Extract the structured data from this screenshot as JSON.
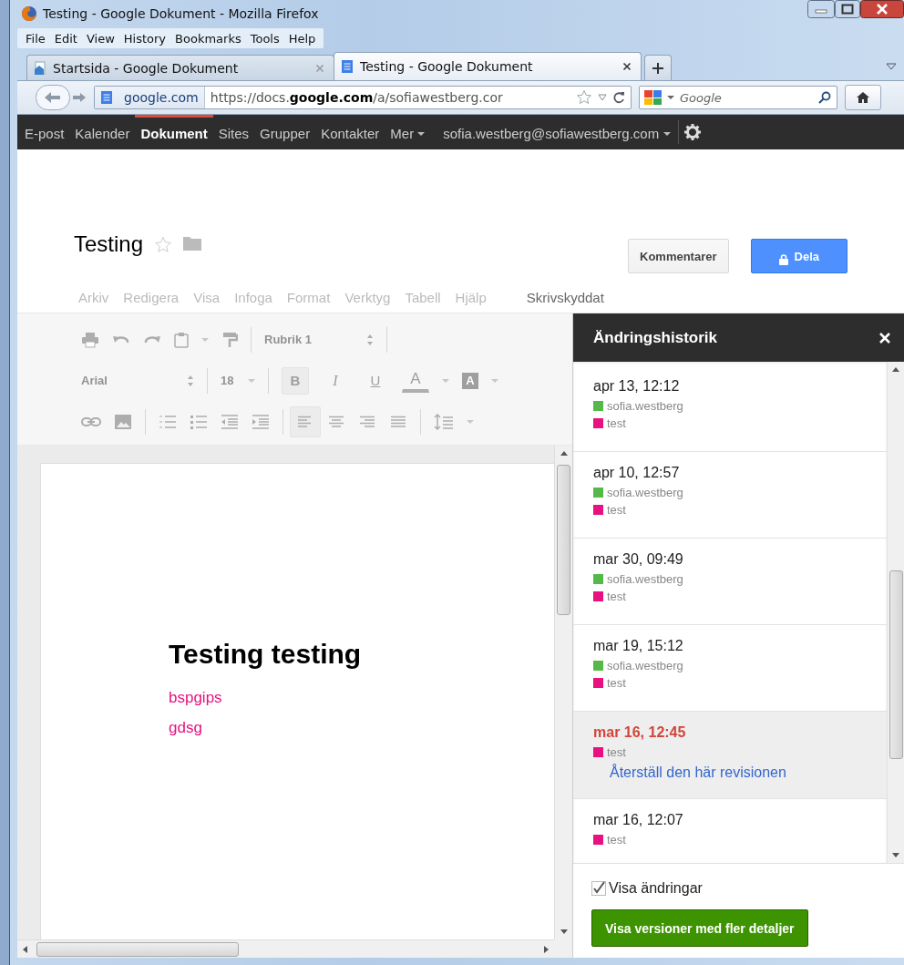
{
  "window": {
    "title": "Testing - Google Dokument - Mozilla Firefox"
  },
  "menu_bar": [
    {
      "label": "File"
    },
    {
      "label": "Edit"
    },
    {
      "label": "View"
    },
    {
      "label": "History"
    },
    {
      "label": "Bookmarks"
    },
    {
      "label": "Tools"
    },
    {
      "label": "Help"
    }
  ],
  "tabs": [
    {
      "label": "Startsida - Google Dokument",
      "selected": false
    },
    {
      "label": "Testing - Google Dokument",
      "selected": true
    }
  ],
  "address_bar": {
    "site": "google.com",
    "url": "https://docs.**google.com**/a/sofiawestberg.cor"
  },
  "search": {
    "placeholder": "Google"
  },
  "google_bar": {
    "items": [
      {
        "label": "E-post",
        "selected": false,
        "dropdown": false
      },
      {
        "label": "Kalender",
        "selected": false,
        "dropdown": false
      },
      {
        "label": "Dokument",
        "selected": true,
        "dropdown": false
      },
      {
        "label": "Sites",
        "selected": false,
        "dropdown": false
      },
      {
        "label": "Grupper",
        "selected": false,
        "dropdown": false
      },
      {
        "label": "Kontakter",
        "selected": false,
        "dropdown": false
      },
      {
        "label": "Mer",
        "selected": false,
        "dropdown": true
      }
    ],
    "account": "sofia.westberg@sofiawestberg.com"
  },
  "document": {
    "title": "Testing",
    "starred": false,
    "menu": [
      {
        "label": "Arkiv",
        "disabled": true
      },
      {
        "label": "Redigera",
        "disabled": true
      },
      {
        "label": "Visa",
        "disabled": true
      },
      {
        "label": "Infoga",
        "disabled": true
      },
      {
        "label": "Format",
        "disabled": true
      },
      {
        "label": "Verktyg",
        "disabled": true
      },
      {
        "label": "Tabell",
        "disabled": true
      },
      {
        "label": "Hjälp",
        "disabled": true
      }
    ],
    "status": "Skrivskyddat",
    "buttons": [
      {
        "label": "Kommentarer",
        "kind": "plain"
      },
      {
        "label": "Dela",
        "kind": "share"
      }
    ]
  },
  "toolbar": {
    "disabled": true,
    "paragraph_style": "Rubrik 1",
    "font": "Arial",
    "font_size": "18",
    "align_buttons": [
      {
        "kind": "left",
        "pressed": true
      },
      {
        "kind": "center",
        "pressed": false
      },
      {
        "kind": "right",
        "pressed": false
      },
      {
        "kind": "justify",
        "pressed": false
      }
    ],
    "format_buttons": [
      {
        "label": "B",
        "kind": "bold",
        "pressed": true
      },
      {
        "label": "I",
        "kind": "italic",
        "pressed": false
      },
      {
        "label": "U",
        "kind": "underline",
        "pressed": false
      },
      {
        "label": "A",
        "kind": "text_color",
        "pressed": false
      },
      {
        "label": "A",
        "kind": "highlight",
        "pressed": false
      }
    ]
  },
  "page": {
    "heading": "Testing testing",
    "lines": [
      {
        "text": "bspgips",
        "color": "#e8117f"
      },
      {
        "text": "gdsg",
        "color": "#e8117f"
      }
    ]
  },
  "history": {
    "title": "Ändringshistorik",
    "revisions": [
      {
        "time": "apr 13, 12:12",
        "selected": false,
        "authors": [
          {
            "name": "sofia.westberg",
            "color": "#54b948"
          },
          {
            "name": "test",
            "color": "#e8117f"
          }
        ]
      },
      {
        "time": "apr 10, 12:57",
        "selected": false,
        "authors": [
          {
            "name": "sofia.westberg",
            "color": "#54b948"
          },
          {
            "name": "test",
            "color": "#e8117f"
          }
        ]
      },
      {
        "time": "mar 30, 09:49",
        "selected": false,
        "authors": [
          {
            "name": "sofia.westberg",
            "color": "#54b948"
          },
          {
            "name": "test",
            "color": "#e8117f"
          }
        ]
      },
      {
        "time": "mar 19, 15:12",
        "selected": false,
        "authors": [
          {
            "name": "sofia.westberg",
            "color": "#54b948"
          },
          {
            "name": "test",
            "color": "#e8117f"
          }
        ]
      },
      {
        "time": "mar 16, 12:45",
        "selected": true,
        "authors": [
          {
            "name": "test",
            "color": "#e8117f"
          }
        ],
        "restore": "Återställ den här revisionen"
      },
      {
        "time": "mar 16, 12:07",
        "selected": false,
        "authors": [
          {
            "name": "test",
            "color": "#e8117f"
          }
        ]
      }
    ],
    "show_changes": {
      "label": "Visa ändringar",
      "checked": true
    },
    "details_button": "Visa versioner med fler detaljer"
  }
}
